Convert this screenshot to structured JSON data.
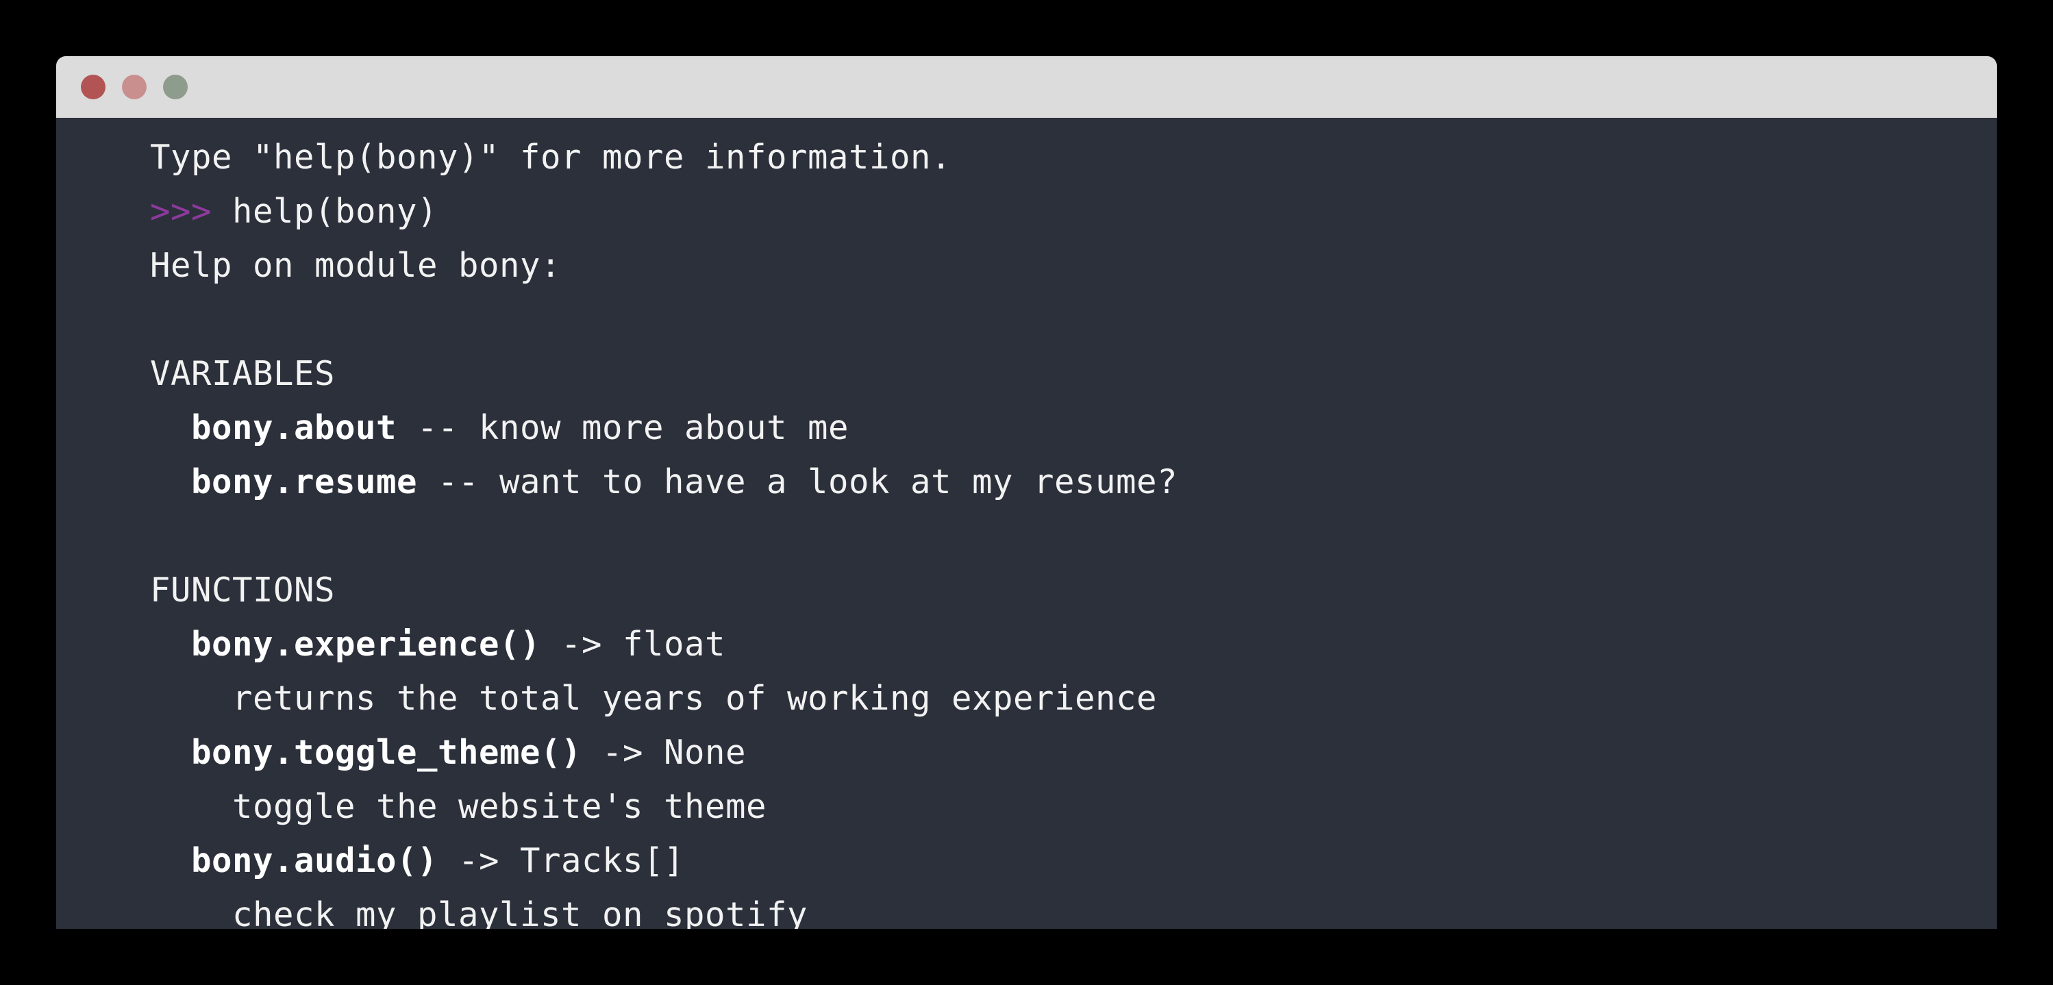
{
  "window": {
    "title_bar": {
      "buttons": [
        {
          "name": "close",
          "color": "#b35454"
        },
        {
          "name": "minimize",
          "color": "#c98f8f"
        },
        {
          "name": "zoom",
          "color": "#8d9c8d"
        }
      ]
    },
    "background_color": "#2b303b",
    "title_bar_color": "#dcdcdc",
    "page_background": "#000000"
  },
  "terminal": {
    "prompt_symbol": ">>>",
    "prompt_color": "#8e3a9c",
    "text_color": "#f2f2f2",
    "lines": [
      {
        "type": "plain",
        "text": "Type \"help(bony)\" for more information."
      },
      {
        "type": "prompt",
        "prompt": ">>> ",
        "text": "help(bony)"
      },
      {
        "type": "plain",
        "text": "Help on module bony:"
      },
      {
        "type": "blank",
        "text": ""
      },
      {
        "type": "plain",
        "text": "VARIABLES"
      },
      {
        "type": "entry",
        "indent": "  ",
        "bold": "bony.about",
        "rest": " -- know more about me"
      },
      {
        "type": "entry",
        "indent": "  ",
        "bold": "bony.resume",
        "rest": " -- want to have a look at my resume?"
      },
      {
        "type": "blank",
        "text": ""
      },
      {
        "type": "plain",
        "text": "FUNCTIONS"
      },
      {
        "type": "entry",
        "indent": "  ",
        "bold": "bony.experience()",
        "rest": " -> float"
      },
      {
        "type": "plain",
        "text": "    returns the total years of working experience"
      },
      {
        "type": "entry",
        "indent": "  ",
        "bold": "bony.toggle_theme()",
        "rest": " -> None"
      },
      {
        "type": "plain",
        "text": "    toggle the website's theme"
      },
      {
        "type": "entry",
        "indent": "  ",
        "bold": "bony.audio()",
        "rest": " -> Tracks[]"
      },
      {
        "type": "plain",
        "text": "    check my playlist on spotify"
      }
    ]
  }
}
